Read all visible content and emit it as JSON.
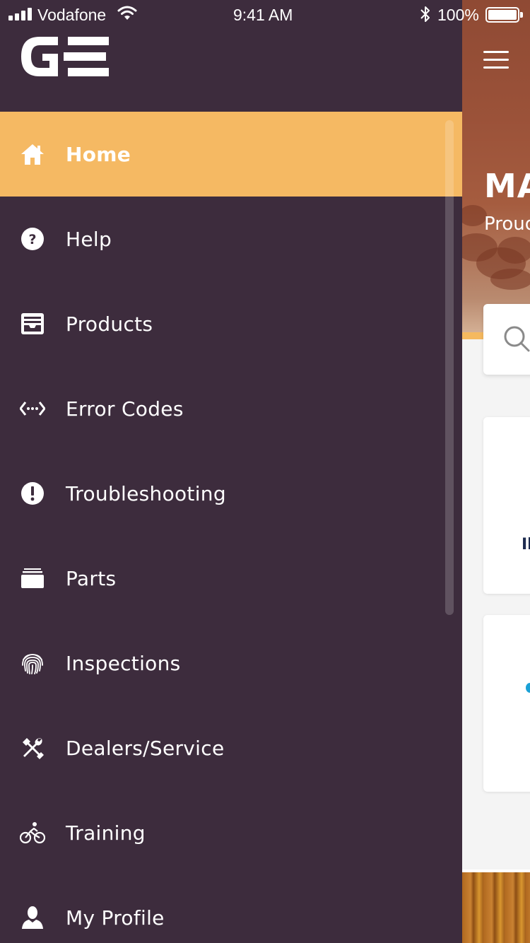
{
  "status_bar": {
    "carrier": "Vodafone",
    "time": "9:41 AM",
    "battery": "100%"
  },
  "app": {
    "logo_icon": "ge-logo-icon"
  },
  "menu": {
    "items": [
      {
        "label": "Home",
        "icon": "home-icon",
        "active": true
      },
      {
        "label": "Help",
        "icon": "help-icon",
        "active": false
      },
      {
        "label": "Products",
        "icon": "products-icon",
        "active": false
      },
      {
        "label": "Error Codes",
        "icon": "code-icon",
        "active": false
      },
      {
        "label": "Troubleshooting",
        "icon": "alert-icon",
        "active": false
      },
      {
        "label": "Parts",
        "icon": "parts-icon",
        "active": false
      },
      {
        "label": "Inspections",
        "icon": "fingerprint-icon",
        "active": false
      },
      {
        "label": "Dealers/Service",
        "icon": "tools-icon",
        "active": false
      },
      {
        "label": "Training",
        "icon": "bicycle-icon",
        "active": false
      },
      {
        "label": "My Profile",
        "icon": "user-icon",
        "active": false
      }
    ]
  },
  "background_page": {
    "title": "MA",
    "subtitle": "Proud",
    "card_text": "Il"
  },
  "colors": {
    "drawer_bg": "#3d2c3d",
    "active_item": "#f5b963",
    "text": "#ffffff"
  }
}
